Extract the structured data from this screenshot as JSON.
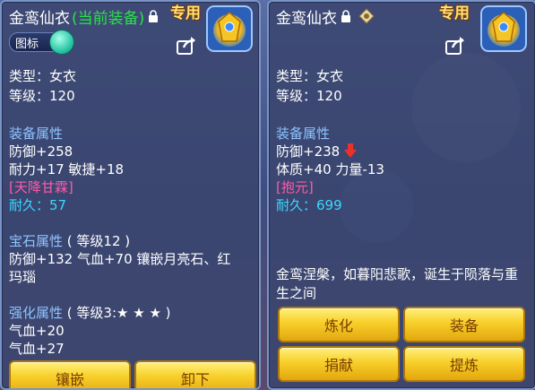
{
  "left": {
    "title_name": "金鸾仙衣",
    "title_tag": "(当前装备)",
    "exclusive_label": "专用",
    "toggle_label": "图标",
    "type_line": "类型：女衣",
    "level_line": "等级：120",
    "equip_attr_header": "装备属性",
    "defense_line": "防御+258",
    "endurance_agility_line": "耐力+17 敏捷+18",
    "special_line": "[天降甘霖]",
    "durability_line": "耐久：57",
    "gem_header": "宝石属性",
    "gem_level": "( 等级12 )",
    "gem_line1": "防御+132 气血+70 镶嵌月亮石、红",
    "gem_line2": "玛瑙",
    "enhance_header": "强化属性",
    "enhance_level": "( 等级3:",
    "enhance_stars": "★ ★ ★ )",
    "enhance_line1": "气血+20",
    "enhance_line2": "气血+27",
    "buttons": [
      "镶嵌",
      "卸下"
    ]
  },
  "right": {
    "title_name": "金鸾仙衣",
    "exclusive_label": "专用",
    "type_line": "类型：女衣",
    "level_line": "等级：120",
    "equip_attr_header": "装备属性",
    "defense_line": "防御+238",
    "physique_strength_line": "体质+40 力量-13",
    "special_line": "[抱元]",
    "durability_line": "耐久：699",
    "description": "金鸾涅槃，如暮阳悲歌，诞生于陨落与重生之间",
    "buttons": [
      "炼化",
      "装备",
      "捐献",
      "提炼"
    ]
  },
  "colors": {
    "equipped_tag": "#2be04a",
    "attr_header": "#8fc4ff",
    "durability": "#3ad8ff",
    "special": "#ff5aa8",
    "button_gold": "#f7cf2a",
    "down_arrow": "#e8322a"
  },
  "icons": [
    "lock-icon",
    "badge-icon",
    "share-icon",
    "item-treasure-icon",
    "down-arrow-icon"
  ]
}
